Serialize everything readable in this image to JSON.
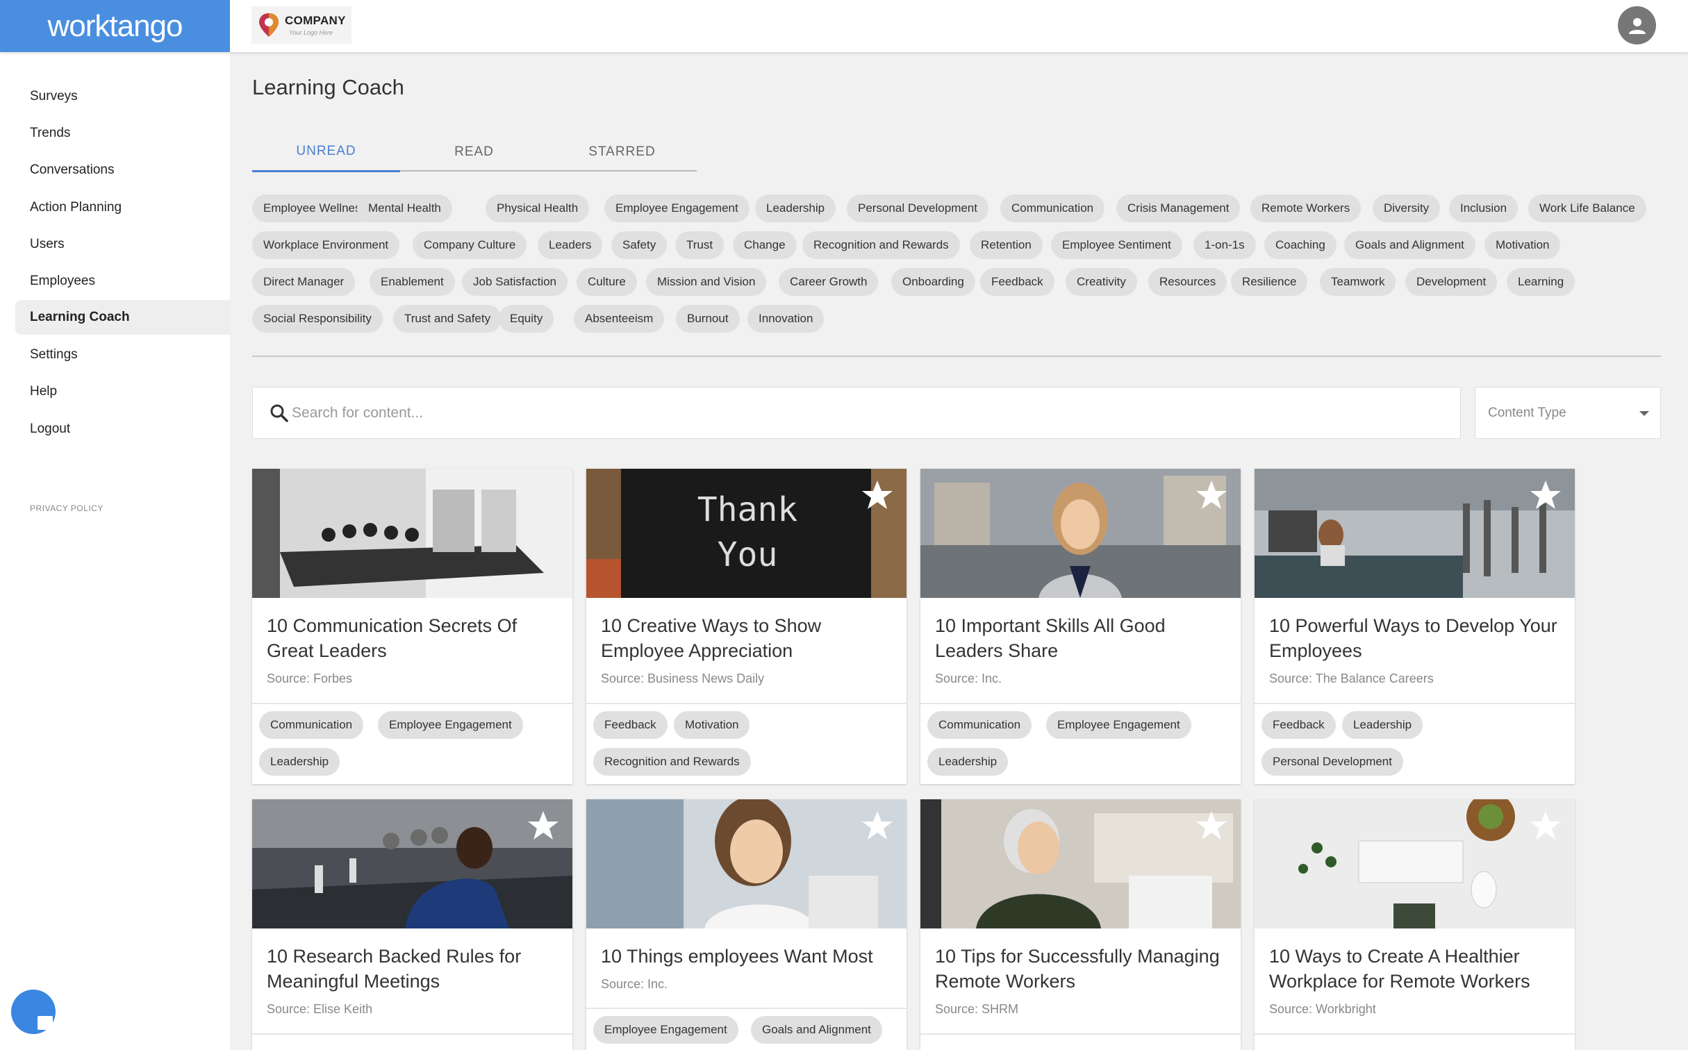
{
  "brand": {
    "name": "worktango"
  },
  "company_logo": {
    "name": "COMPANY",
    "tagline": "Your Logo Here"
  },
  "sidebar": {
    "items": [
      {
        "label": "Surveys",
        "active": false
      },
      {
        "label": "Trends",
        "active": false
      },
      {
        "label": "Conversations",
        "active": false
      },
      {
        "label": "Action Planning",
        "active": false
      },
      {
        "label": "Users",
        "active": false
      },
      {
        "label": "Employees",
        "active": false
      },
      {
        "label": "Learning Coach",
        "active": true
      },
      {
        "label": "Settings",
        "active": false
      },
      {
        "label": "Help",
        "active": false
      },
      {
        "label": "Logout",
        "active": false
      }
    ],
    "privacy_policy": "PRIVACY POLICY"
  },
  "main": {
    "title": "Learning Coach",
    "tabs": [
      {
        "label": "UNREAD",
        "active": true
      },
      {
        "label": "READ",
        "active": false
      },
      {
        "label": "STARRED",
        "active": false
      }
    ],
    "topics": [
      [
        "Employee Wellness",
        "Mental Health",
        "Physical Health",
        "Employee Engagement",
        "Leadership",
        "Personal Development",
        "Communication",
        "Crisis Management",
        "Remote Workers",
        "Diversity",
        "Inclusion",
        "Work Life Balance"
      ],
      [
        "Workplace Environment",
        "Company Culture",
        "Leaders",
        "Safety",
        "Trust",
        "Change",
        "Recognition and Rewards",
        "Retention",
        "Employee Sentiment",
        "1-on-1s",
        "Coaching",
        "Goals and Alignment",
        "Motivation"
      ],
      [
        "Direct Manager",
        "Enablement",
        "Job Satisfaction",
        "Culture",
        "Mission and Vision",
        "Career Growth",
        "Onboarding",
        "Feedback",
        "Creativity",
        "Resources",
        "Resilience",
        "Teamwork",
        "Development",
        "Learning"
      ],
      [
        "Social Responsibility",
        "Trust and Safety",
        "Equity",
        "Absenteeism",
        "Burnout",
        "Innovation"
      ]
    ],
    "search": {
      "placeholder": "Search for content...",
      "value": ""
    },
    "content_type": {
      "selected": "Content Type"
    }
  },
  "cards": [
    {
      "title": "10 Communication Secrets Of Great Leaders",
      "source": "Source: Forbes",
      "tags": [
        "Communication",
        "Employee Engagement",
        "Leadership"
      ],
      "starred_icon": false,
      "image": "meeting-room"
    },
    {
      "title": "10 Creative Ways to Show Employee Appreciation",
      "source": "Source: Business News Daily",
      "tags": [
        "Feedback",
        "Motivation",
        "Recognition and Rewards"
      ],
      "starred_icon": true,
      "image": "thank-you-board",
      "image_text": [
        "Thank",
        "You"
      ]
    },
    {
      "title": "10 Important Skills All Good Leaders Share",
      "source": "Source: Inc.",
      "tags": [
        "Communication",
        "Employee Engagement",
        "Leadership"
      ],
      "starred_icon": true,
      "image": "woman-street"
    },
    {
      "title": "10 Powerful Ways to Develop Your Employees",
      "source": "Source: The Balance Careers",
      "tags": [
        "Feedback",
        "Leadership",
        "Personal Development"
      ],
      "starred_icon": true,
      "image": "office-lobby"
    },
    {
      "title": "10 Research Backed Rules for Meaningful Meetings",
      "source": "Source: Elise Keith",
      "tags": [],
      "starred_icon": true,
      "image": "conference-table"
    },
    {
      "title": "10 Things employees Want Most",
      "source": "Source: Inc.",
      "tags": [
        "Employee Engagement",
        "Goals and Alignment"
      ],
      "starred_icon": true,
      "image": "woman-phone"
    },
    {
      "title": "10 Tips for Successfully Managing Remote Workers",
      "source": "Source: SHRM",
      "tags": [],
      "starred_icon": true,
      "image": "woman-laptop"
    },
    {
      "title": "10 Ways to Create A Healthier Workplace for Remote Workers",
      "source": "Source: Workbright",
      "tags": [],
      "starred_icon": true,
      "image": "desk-top-view"
    }
  ],
  "colors": {
    "brand": "#4a8ee0",
    "accent": "#4a7ed0",
    "chip": "#e0e0e0"
  }
}
